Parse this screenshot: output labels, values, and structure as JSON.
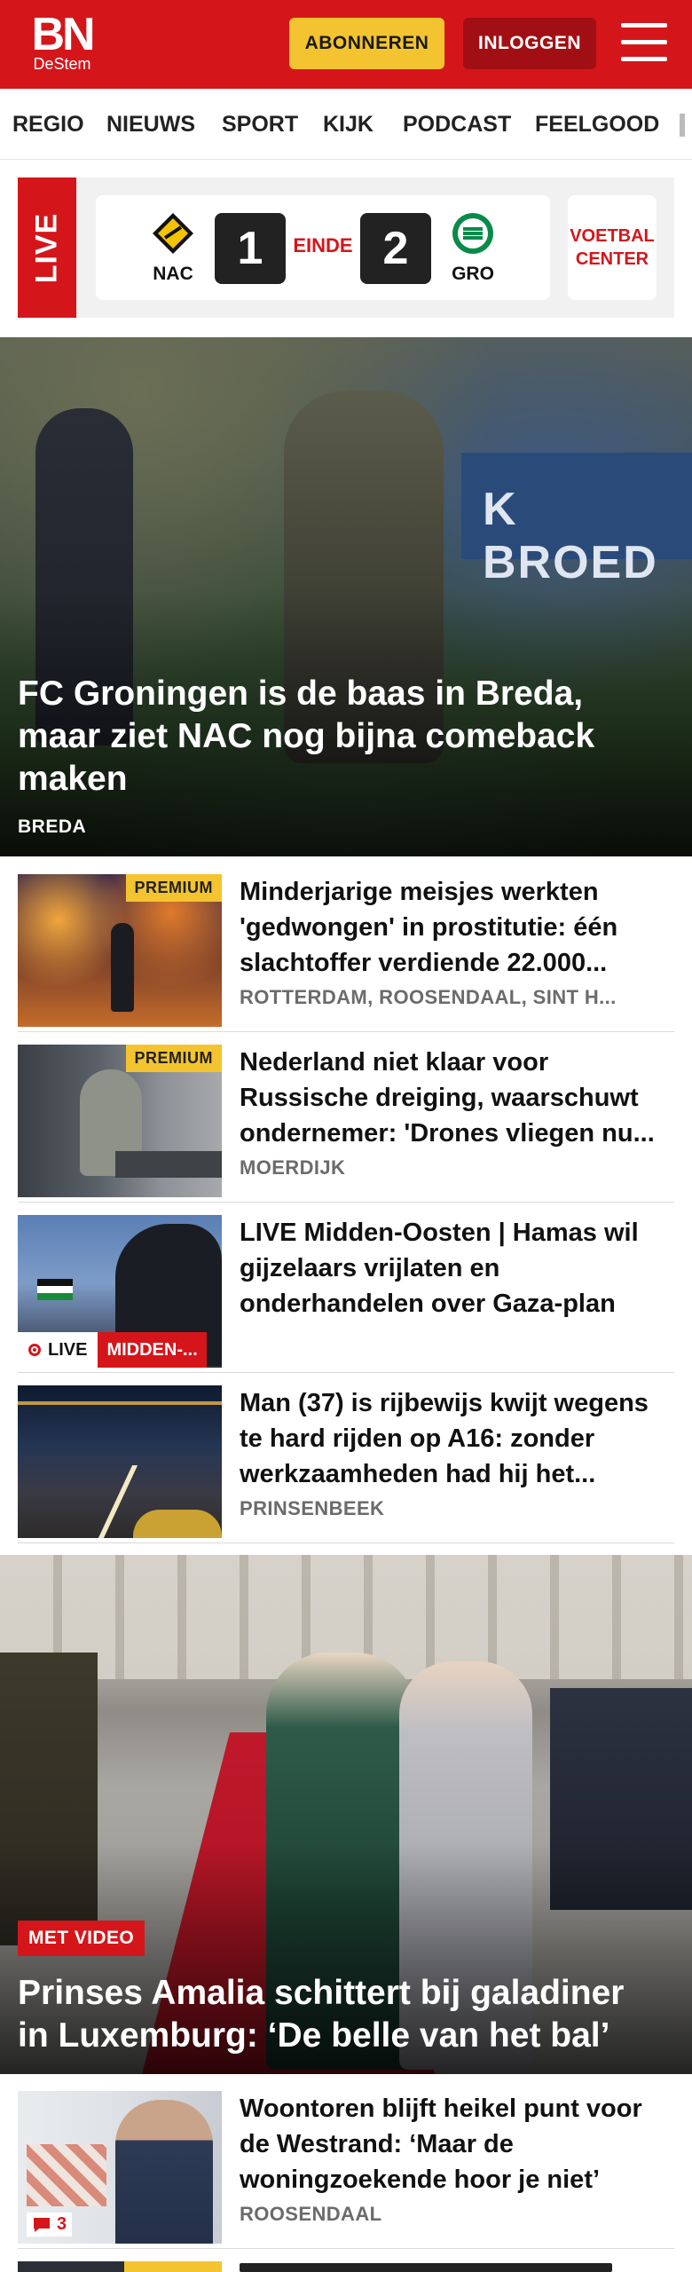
{
  "header": {
    "logo_main": "BN",
    "logo_sub": "DeStem",
    "subscribe_label": "ABONNEREN",
    "login_label": "INLOGGEN"
  },
  "nav": {
    "items": [
      "REGIO",
      "NIEUWS",
      "SPORT",
      "KIJK",
      "PODCAST",
      "FEELGOOD"
    ]
  },
  "live_score": {
    "live_label": "LIVE",
    "home_team": "NAC",
    "home_score": "1",
    "status": "EINDE",
    "away_score": "2",
    "away_team": "GRO",
    "center_label": "VOETBAL CENTER"
  },
  "hero1": {
    "title": "FC Groningen is de baas in Breda, maar ziet NAC nog bijna comeback maken",
    "label": "BREDA",
    "board_text": "K BROED"
  },
  "articles": [
    {
      "badge": "PREMIUM",
      "title": "Minderjarige meisjes werkten 'gedwongen' in prostitutie: één slachtoffer verdiende 22.000...",
      "meta": "ROTTERDAM, ROOSENDAAL, SINT H..."
    },
    {
      "badge": "PREMIUM",
      "title": "Nederland niet klaar voor Russische dreiging, waarschuwt ondernemer: 'Drones vliegen nu...",
      "meta": "MOERDIJK"
    },
    {
      "live_label": "LIVE",
      "section": "MIDDEN-...",
      "title": "LIVE Midden-Oosten | Hamas wil gijzelaars vrijlaten en onderhandelen over Gaza-plan"
    },
    {
      "title": "Man (37) is rijbewijs kwijt wegens te hard rijden op A16: zonder werkzaamheden had hij het...",
      "meta": "PRINSENBEEK"
    }
  ],
  "hero2": {
    "tag": "MET VIDEO",
    "title": "Prinses Amalia schittert bij galadiner in Luxemburg: ‘De belle van het bal’"
  },
  "article5": {
    "title": "Woontoren blijft heikel punt voor de Westrand: ‘Maar de woningzoekende hoor je niet’",
    "meta": "ROOSENDAAL",
    "comments": "3"
  },
  "colors": {
    "brand_red": "#d4161b",
    "subscribe_yellow": "#f4c430",
    "login_dark_red": "#a10f14"
  }
}
